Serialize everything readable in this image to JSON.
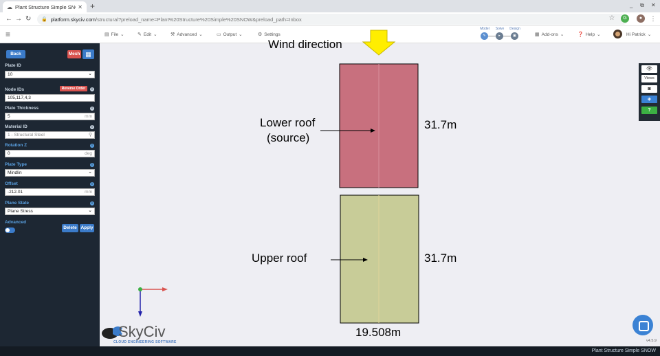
{
  "browser": {
    "tab_title": "Plant Structure Simple SNO",
    "tab_close": "✕",
    "new_tab": "+",
    "url_host": "platform.skyciv.com",
    "url_path": "/structural?preload_name=Plant%20Structure%20Simple%20SNOW&preload_path=Inbox",
    "win_min": "_",
    "win_restore": "⧉",
    "win_close": "✕"
  },
  "toolbar": {
    "menus": [
      "File",
      "Edit",
      "Advanced",
      "Output",
      "Settings"
    ],
    "steps": [
      "Model",
      "Solve",
      "Design"
    ],
    "addons": "Add-ons",
    "help": "Help",
    "greeting": "Hi Patrick"
  },
  "sidebar": {
    "back": "Back",
    "mesh": "Mesh",
    "plate_id_label": "Plate ID",
    "plate_id_value": "10",
    "node_ids_label": "Node IDs",
    "reverse_order": "Reverse Order",
    "node_ids_value": "105,117,4,3",
    "thickness_label": "Plate Thickness",
    "thickness_value": "5",
    "thickness_unit": "mm",
    "material_label": "Material ID",
    "material_value": "1 - Structural Steel",
    "rotation_label": "Rotation Z",
    "rotation_value": "0",
    "rotation_unit": "deg",
    "plate_type_label": "Plate Type",
    "plate_type_value": "Mindlin",
    "offset_label": "Offset",
    "offset_value": "-212.01",
    "offset_unit": "mm",
    "plane_state_label": "Plane State",
    "plane_state_value": "Plane Stress",
    "advanced_label": "Advanced",
    "delete": "Delete",
    "apply": "Apply"
  },
  "viewport": {
    "wind_direction": "Wind direction",
    "lower_roof_line1": "Lower roof",
    "lower_roof_line2": "(source)",
    "upper_roof": "Upper roof",
    "dim_top": "31.7m",
    "dim_bottom": "31.7m",
    "dim_width": "19.508m",
    "lower_roof_color": "#c8707e",
    "upper_roof_color": "#c8cc98",
    "arrow_color": "#ffee00"
  },
  "right_panel": {
    "views": "Views"
  },
  "logo": {
    "name": "SkyCiv",
    "tagline": "CLOUD ENGINEERING SOFTWARE"
  },
  "status": {
    "version": "v4.5.9",
    "project": "Plant Structure Simple SNOW"
  }
}
